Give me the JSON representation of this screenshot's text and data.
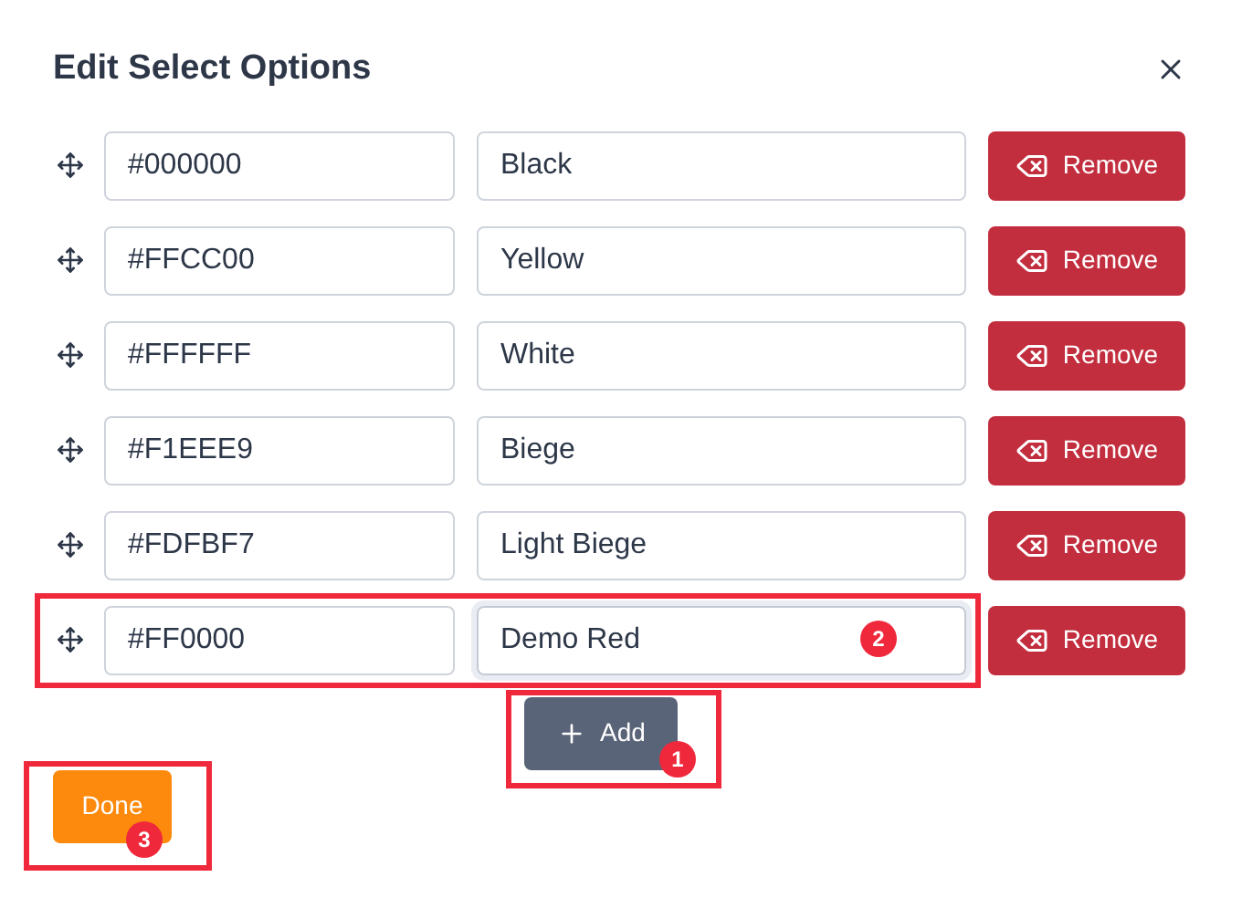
{
  "dialog": {
    "title": "Edit Select Options"
  },
  "options": [
    {
      "value": "#000000",
      "label": "Black",
      "focused": false,
      "remove": "Remove"
    },
    {
      "value": "#FFCC00",
      "label": "Yellow",
      "focused": false,
      "remove": "Remove"
    },
    {
      "value": "#FFFFFF",
      "label": "White",
      "focused": false,
      "remove": "Remove"
    },
    {
      "value": "#F1EEE9",
      "label": "Biege",
      "focused": false,
      "remove": "Remove"
    },
    {
      "value": "#FDFBF7",
      "label": "Light Biege",
      "focused": false,
      "remove": "Remove"
    },
    {
      "value": "#FF0000",
      "label": "Demo Red",
      "focused": true,
      "remove": "Remove",
      "annotation": "2"
    }
  ],
  "add_button": {
    "label": "Add",
    "annotation": "1"
  },
  "done_button": {
    "label": "Done",
    "annotation": "3"
  }
}
